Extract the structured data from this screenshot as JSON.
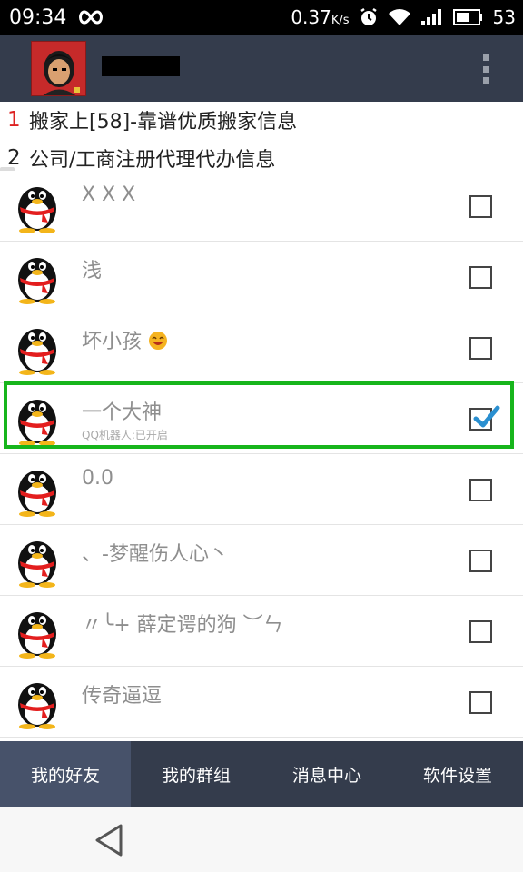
{
  "status_bar": {
    "time": "09:34",
    "infinity_icon": "infinity-icon",
    "speed": "0.37",
    "speed_unit": "K/s",
    "alarm_icon": "alarm-clock-icon",
    "wifi_icon": "wifi-icon",
    "signal_icon": "signal-bars-icon",
    "battery_icon": "battery-icon",
    "battery_level": "53"
  },
  "app_bar": {
    "avatar": "user-avatar",
    "menu_icon": "overflow-menu-icon"
  },
  "ads": [
    {
      "num": "1",
      "text": "搬家上[58]-靠谱优质搬家信息"
    },
    {
      "num": "2",
      "text": "公司/工商注册代理代办信息"
    }
  ],
  "contacts": [
    {
      "name": "X X X",
      "sub": "",
      "checked": false
    },
    {
      "name": "浅",
      "sub": "",
      "checked": false
    },
    {
      "name": "坏小孩",
      "sub": "",
      "checked": false,
      "emoji": "smiling-face-emoji"
    },
    {
      "name": "一个大神",
      "sub": "QQ机器人:已开启",
      "checked": true
    },
    {
      "name": "0.0",
      "sub": "",
      "checked": false
    },
    {
      "name": "、-梦醒伤人心丶",
      "sub": "",
      "checked": false
    },
    {
      "name": "〃╰+ 薛定谔的狗 ︶ㄣ",
      "sub": "",
      "checked": false
    },
    {
      "name": "传奇逼逗",
      "sub": "",
      "checked": false
    }
  ],
  "tabs": [
    {
      "label": "我的好友",
      "active": true
    },
    {
      "label": "我的群组",
      "active": false
    },
    {
      "label": "消息中心",
      "active": false
    },
    {
      "label": "软件设置",
      "active": false
    }
  ],
  "nav": {
    "back_icon": "back-triangle-icon"
  },
  "colors": {
    "app_bar": "#343c4c",
    "active_tab": "#47526a",
    "highlight": "#17b51c",
    "check": "#2a8fd0"
  }
}
